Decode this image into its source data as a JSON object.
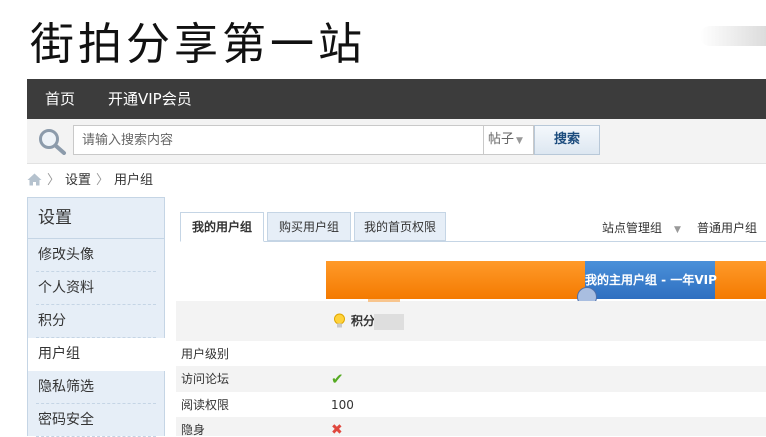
{
  "site_title": "街拍分享第一站",
  "nav": {
    "items": [
      "首页",
      "开通VIP会员"
    ]
  },
  "search": {
    "placeholder": "请输入搜索内容",
    "type": "帖子",
    "button": "搜索"
  },
  "breadcrumb": {
    "items": [
      "设置",
      "用户组"
    ]
  },
  "sidebar": {
    "title": "设置",
    "items": [
      "修改头像",
      "个人资料",
      "积分",
      "用户组",
      "隐私筛选",
      "密码安全"
    ],
    "active": "用户组"
  },
  "tabs": [
    "我的用户组",
    "购买用户组",
    "我的首页权限"
  ],
  "active_tab": "我的用户组",
  "right_links": [
    "站点管理组",
    "普通用户组"
  ],
  "group_bar": {
    "label": "我的主用户组 - 一年VIP"
  },
  "points_label": "积分",
  "permissions": [
    {
      "label": "用户级别",
      "value": ""
    },
    {
      "label": "访问论坛",
      "value": "✔"
    },
    {
      "label": "阅读权限",
      "value": "100"
    },
    {
      "label": "隐身",
      "value": "✖"
    }
  ],
  "colors": {
    "nav_bg": "#3c3c3c",
    "accent_orange": "#f47a00",
    "accent_blue": "#2f6fc0",
    "sidebar_bg": "#e6eef7"
  }
}
